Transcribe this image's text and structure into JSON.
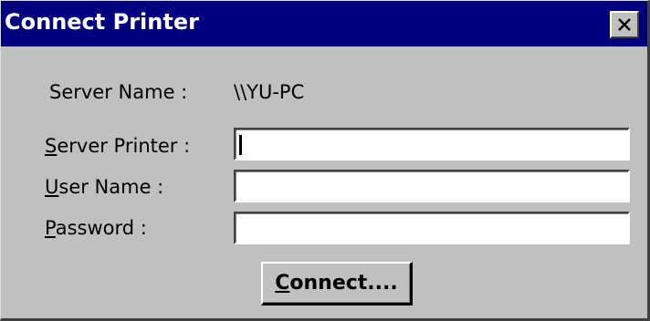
{
  "window": {
    "title": "Connect Printer",
    "close_symbol": "×"
  },
  "server_name": {
    "label": "Server Name :",
    "value": "\\\\YU-PC"
  },
  "server_printer": {
    "label_mnemonic": "S",
    "label_rest": "erver Printer :",
    "value": ""
  },
  "user_name": {
    "label_mnemonic": "U",
    "label_rest": "ser Name :",
    "value": ""
  },
  "password": {
    "label_mnemonic": "P",
    "label_rest": "assword :",
    "value": ""
  },
  "connect_button": {
    "label_mnemonic": "C",
    "label_rest": "onnect...."
  },
  "colors": {
    "titlebar": "#00007f",
    "window_face": "#c0c0c0",
    "field_bg": "#ffffff"
  }
}
